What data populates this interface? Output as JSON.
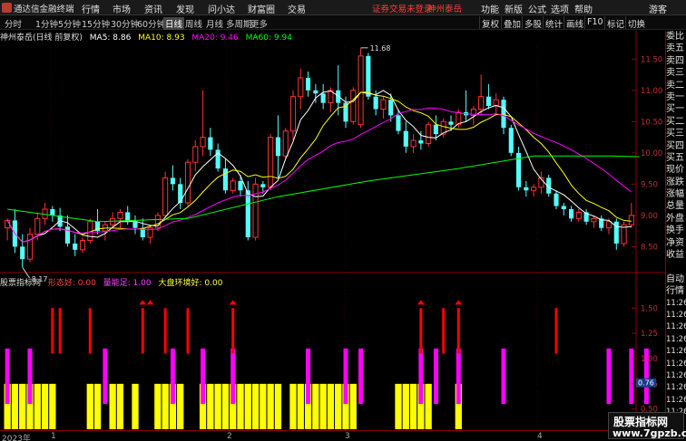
{
  "menu": {
    "app_title": "通达信金融终端",
    "items": [
      "行情",
      "市场",
      "资讯",
      "发现",
      "问小达",
      "财富圈",
      "交易"
    ],
    "notice": "证券交易未登录",
    "account": "神州泰岳",
    "right": [
      "功能",
      "新版",
      "公式",
      "选项",
      "帮助"
    ],
    "guest": "游客"
  },
  "periods": [
    "分时",
    "1分钟",
    "5分钟",
    "15分钟",
    "30分钟",
    "60分钟",
    "日线",
    "周线",
    "月线",
    "多周期",
    "更多"
  ],
  "active_period": "日线",
  "tools": [
    "复权",
    "叠加",
    "多股",
    "统计",
    "画线",
    "F10",
    "标记",
    "切换"
  ],
  "kline_header": {
    "stock": "神州泰岳(日线 前复权)",
    "ma5": "MA5: 8.86",
    "ma10": "MA10: 8.93",
    "ma20": "MA20: 9.46",
    "ma60": "MA60: 9.94"
  },
  "price_axis": [
    "11.50",
    "11.00",
    "10.50",
    "10.00",
    "9.50",
    "9.00",
    "8.50"
  ],
  "high_label": "11.68",
  "low_label": "8.17",
  "indicator_header": {
    "name": "股票指标网",
    "l1": "形态好: 0.00",
    "l2": "量能足: 1.00",
    "l3": "大盘环境好: 0.00"
  },
  "ind_axis": [
    "1.50",
    "1.25",
    "1.00",
    "0.75",
    "0.50"
  ],
  "ind_current": "0.76",
  "side_labels": [
    "委比",
    "卖五",
    "卖四",
    "卖三",
    "卖二",
    "卖一",
    "买一",
    "买二",
    "买三",
    "买四",
    "买五",
    "现价",
    "涨跌",
    "涨幅",
    "总量",
    "外盘",
    "换手",
    "净资",
    "收益",
    "",
    "自动",
    "行情"
  ],
  "side_times": [
    "11:26",
    "11:26",
    "11:26",
    "11:26",
    "11:26",
    "11:26",
    "11:26",
    "11:26",
    "11:26",
    "11:26"
  ],
  "dates": [
    "2023年",
    "1",
    "2",
    "3",
    "4"
  ],
  "watermark": {
    "line1": "股票指标网",
    "line2": "www.7gpzb.com"
  },
  "colors": {
    "up": "#ff3232",
    "down": "#54ffff",
    "ma5": "#ffffff",
    "ma10": "#ffff00",
    "ma20": "#ff00ff",
    "ma60": "#00ff00",
    "xingtai": "#ff0000",
    "liangneng": "#ff00ff",
    "dapan": "#ffff00"
  },
  "chart_data": {
    "type": "candlestick",
    "ylim": [
      8.1,
      11.75
    ],
    "candles": [
      {
        "o": 8.8,
        "h": 8.95,
        "l": 8.6,
        "c": 8.92
      },
      {
        "o": 8.92,
        "h": 9.1,
        "l": 8.4,
        "c": 8.5
      },
      {
        "o": 8.5,
        "h": 8.7,
        "l": 8.17,
        "c": 8.3
      },
      {
        "o": 8.3,
        "h": 8.8,
        "l": 8.25,
        "c": 8.7
      },
      {
        "o": 8.7,
        "h": 9.05,
        "l": 8.6,
        "c": 8.95
      },
      {
        "o": 8.95,
        "h": 9.2,
        "l": 8.85,
        "c": 9.1
      },
      {
        "o": 9.1,
        "h": 9.15,
        "l": 8.9,
        "c": 9.0
      },
      {
        "o": 9.0,
        "h": 9.12,
        "l": 8.75,
        "c": 8.82
      },
      {
        "o": 8.82,
        "h": 9.0,
        "l": 8.5,
        "c": 8.55
      },
      {
        "o": 8.55,
        "h": 8.7,
        "l": 8.35,
        "c": 8.45
      },
      {
        "o": 8.45,
        "h": 8.65,
        "l": 8.4,
        "c": 8.6
      },
      {
        "o": 8.6,
        "h": 8.95,
        "l": 8.55,
        "c": 8.9
      },
      {
        "o": 8.9,
        "h": 9.1,
        "l": 8.7,
        "c": 8.75
      },
      {
        "o": 8.75,
        "h": 8.9,
        "l": 8.6,
        "c": 8.85
      },
      {
        "o": 8.85,
        "h": 9.05,
        "l": 8.8,
        "c": 8.95
      },
      {
        "o": 8.95,
        "h": 9.1,
        "l": 8.8,
        "c": 9.05
      },
      {
        "o": 9.05,
        "h": 9.15,
        "l": 8.85,
        "c": 8.9
      },
      {
        "o": 8.9,
        "h": 9.0,
        "l": 8.7,
        "c": 8.8
      },
      {
        "o": 8.8,
        "h": 8.95,
        "l": 8.6,
        "c": 8.65
      },
      {
        "o": 8.65,
        "h": 8.85,
        "l": 8.55,
        "c": 8.8
      },
      {
        "o": 8.8,
        "h": 9.05,
        "l": 8.75,
        "c": 9.0
      },
      {
        "o": 9.0,
        "h": 9.7,
        "l": 8.95,
        "c": 9.6
      },
      {
        "o": 9.6,
        "h": 9.8,
        "l": 9.4,
        "c": 9.5
      },
      {
        "o": 9.5,
        "h": 9.6,
        "l": 9.1,
        "c": 9.2
      },
      {
        "o": 9.2,
        "h": 9.9,
        "l": 9.15,
        "c": 9.85
      },
      {
        "o": 9.85,
        "h": 10.2,
        "l": 9.7,
        "c": 10.1
      },
      {
        "o": 10.1,
        "h": 11.0,
        "l": 9.95,
        "c": 10.25
      },
      {
        "o": 10.25,
        "h": 10.4,
        "l": 9.95,
        "c": 10.05
      },
      {
        "o": 10.05,
        "h": 10.15,
        "l": 9.7,
        "c": 9.75
      },
      {
        "o": 9.75,
        "h": 9.9,
        "l": 9.35,
        "c": 9.4
      },
      {
        "o": 9.4,
        "h": 9.6,
        "l": 9.35,
        "c": 9.55
      },
      {
        "o": 9.55,
        "h": 9.65,
        "l": 9.3,
        "c": 9.4
      },
      {
        "o": 9.4,
        "h": 9.55,
        "l": 8.6,
        "c": 8.65
      },
      {
        "o": 8.65,
        "h": 9.6,
        "l": 8.6,
        "c": 9.5
      },
      {
        "o": 9.5,
        "h": 9.55,
        "l": 9.35,
        "c": 9.45
      },
      {
        "o": 9.45,
        "h": 10.3,
        "l": 9.4,
        "c": 10.25
      },
      {
        "o": 10.25,
        "h": 10.6,
        "l": 9.6,
        "c": 9.95
      },
      {
        "o": 9.95,
        "h": 10.4,
        "l": 9.9,
        "c": 10.35
      },
      {
        "o": 10.35,
        "h": 11.0,
        "l": 10.2,
        "c": 10.9
      },
      {
        "o": 10.9,
        "h": 11.35,
        "l": 10.7,
        "c": 11.2
      },
      {
        "o": 11.2,
        "h": 11.3,
        "l": 10.9,
        "c": 11.0
      },
      {
        "o": 11.0,
        "h": 11.1,
        "l": 10.8,
        "c": 10.95
      },
      {
        "o": 10.95,
        "h": 11.1,
        "l": 10.7,
        "c": 10.8
      },
      {
        "o": 10.8,
        "h": 11.05,
        "l": 10.65,
        "c": 11.0
      },
      {
        "o": 11.0,
        "h": 11.4,
        "l": 10.6,
        "c": 10.8
      },
      {
        "o": 10.8,
        "h": 10.9,
        "l": 10.4,
        "c": 10.5
      },
      {
        "o": 10.5,
        "h": 11.05,
        "l": 10.45,
        "c": 11.0
      },
      {
        "o": 10.45,
        "h": 11.68,
        "l": 10.4,
        "c": 11.55
      },
      {
        "o": 11.55,
        "h": 11.6,
        "l": 10.85,
        "c": 10.9
      },
      {
        "o": 10.9,
        "h": 11.0,
        "l": 10.6,
        "c": 10.7
      },
      {
        "o": 10.7,
        "h": 10.9,
        "l": 10.55,
        "c": 10.85
      },
      {
        "o": 10.85,
        "h": 10.95,
        "l": 10.5,
        "c": 10.6
      },
      {
        "o": 10.6,
        "h": 10.7,
        "l": 10.3,
        "c": 10.35
      },
      {
        "o": 10.35,
        "h": 10.5,
        "l": 10.0,
        "c": 10.1
      },
      {
        "o": 10.1,
        "h": 10.3,
        "l": 10.0,
        "c": 10.2
      },
      {
        "o": 10.2,
        "h": 10.35,
        "l": 10.05,
        "c": 10.15
      },
      {
        "o": 10.15,
        "h": 10.5,
        "l": 10.1,
        "c": 10.45
      },
      {
        "o": 10.45,
        "h": 10.6,
        "l": 10.2,
        "c": 10.3
      },
      {
        "o": 10.3,
        "h": 10.55,
        "l": 10.25,
        "c": 10.5
      },
      {
        "o": 10.5,
        "h": 10.6,
        "l": 10.35,
        "c": 10.45
      },
      {
        "o": 10.45,
        "h": 10.7,
        "l": 10.4,
        "c": 10.65
      },
      {
        "o": 10.65,
        "h": 11.0,
        "l": 10.5,
        "c": 10.6
      },
      {
        "o": 10.6,
        "h": 10.75,
        "l": 10.45,
        "c": 10.7
      },
      {
        "o": 10.7,
        "h": 11.25,
        "l": 10.6,
        "c": 10.9
      },
      {
        "o": 10.9,
        "h": 11.1,
        "l": 10.7,
        "c": 10.75
      },
      {
        "o": 10.75,
        "h": 10.95,
        "l": 10.6,
        "c": 10.85
      },
      {
        "o": 10.85,
        "h": 10.9,
        "l": 10.3,
        "c": 10.4
      },
      {
        "o": 10.4,
        "h": 10.45,
        "l": 9.95,
        "c": 10.0
      },
      {
        "o": 10.0,
        "h": 10.1,
        "l": 9.4,
        "c": 9.45
      },
      {
        "o": 9.45,
        "h": 9.55,
        "l": 9.3,
        "c": 9.4
      },
      {
        "o": 9.4,
        "h": 9.5,
        "l": 9.3,
        "c": 9.45
      },
      {
        "o": 9.45,
        "h": 9.7,
        "l": 9.35,
        "c": 9.6
      },
      {
        "o": 9.6,
        "h": 9.65,
        "l": 9.3,
        "c": 9.35
      },
      {
        "o": 9.35,
        "h": 9.4,
        "l": 9.1,
        "c": 9.15
      },
      {
        "o": 9.15,
        "h": 9.2,
        "l": 9.0,
        "c": 9.1
      },
      {
        "o": 9.1,
        "h": 9.15,
        "l": 8.9,
        "c": 8.95
      },
      {
        "o": 8.95,
        "h": 9.1,
        "l": 8.9,
        "c": 9.05
      },
      {
        "o": 9.05,
        "h": 9.1,
        "l": 8.85,
        "c": 8.9
      },
      {
        "o": 8.9,
        "h": 9.0,
        "l": 8.8,
        "c": 8.95
      },
      {
        "o": 8.95,
        "h": 9.0,
        "l": 8.75,
        "c": 8.8
      },
      {
        "o": 8.8,
        "h": 8.95,
        "l": 8.7,
        "c": 8.9
      },
      {
        "o": 8.9,
        "h": 8.95,
        "l": 8.45,
        "c": 8.55
      },
      {
        "o": 8.55,
        "h": 8.9,
        "l": 8.5,
        "c": 8.85
      },
      {
        "o": 8.85,
        "h": 9.2,
        "l": 8.8,
        "c": 9.0
      }
    ],
    "ma60": [
      {
        "i": 0,
        "v": 9.1
      },
      {
        "i": 12,
        "v": 8.9
      },
      {
        "i": 24,
        "v": 8.95
      },
      {
        "i": 36,
        "v": 9.3
      },
      {
        "i": 48,
        "v": 9.55
      },
      {
        "i": 60,
        "v": 9.75
      },
      {
        "i": 70,
        "v": 9.95
      },
      {
        "i": 80,
        "v": 9.95
      },
      {
        "i": 84,
        "v": 9.94
      }
    ],
    "indicator": {
      "ylim": [
        0.3,
        1.7
      ],
      "dapan_bars": [
        0,
        1,
        2,
        3,
        4,
        5,
        6,
        11,
        12,
        14,
        15,
        17,
        20,
        21,
        22,
        23,
        26,
        27,
        28,
        29,
        30,
        31,
        32,
        33,
        34,
        35,
        36,
        38,
        39,
        40,
        41,
        42,
        43,
        44,
        45,
        46,
        52,
        53,
        54,
        55,
        56,
        60
      ],
      "liangneng_bars": [
        0,
        3,
        13,
        22,
        26,
        30,
        40,
        45,
        47,
        55,
        57,
        60,
        66,
        80,
        83,
        85
      ],
      "xingtai_bars": [
        6,
        7,
        11,
        18,
        21,
        24,
        30,
        55,
        58,
        60,
        73
      ],
      "arrow_bars": [
        18,
        19,
        30,
        55,
        60
      ]
    }
  }
}
